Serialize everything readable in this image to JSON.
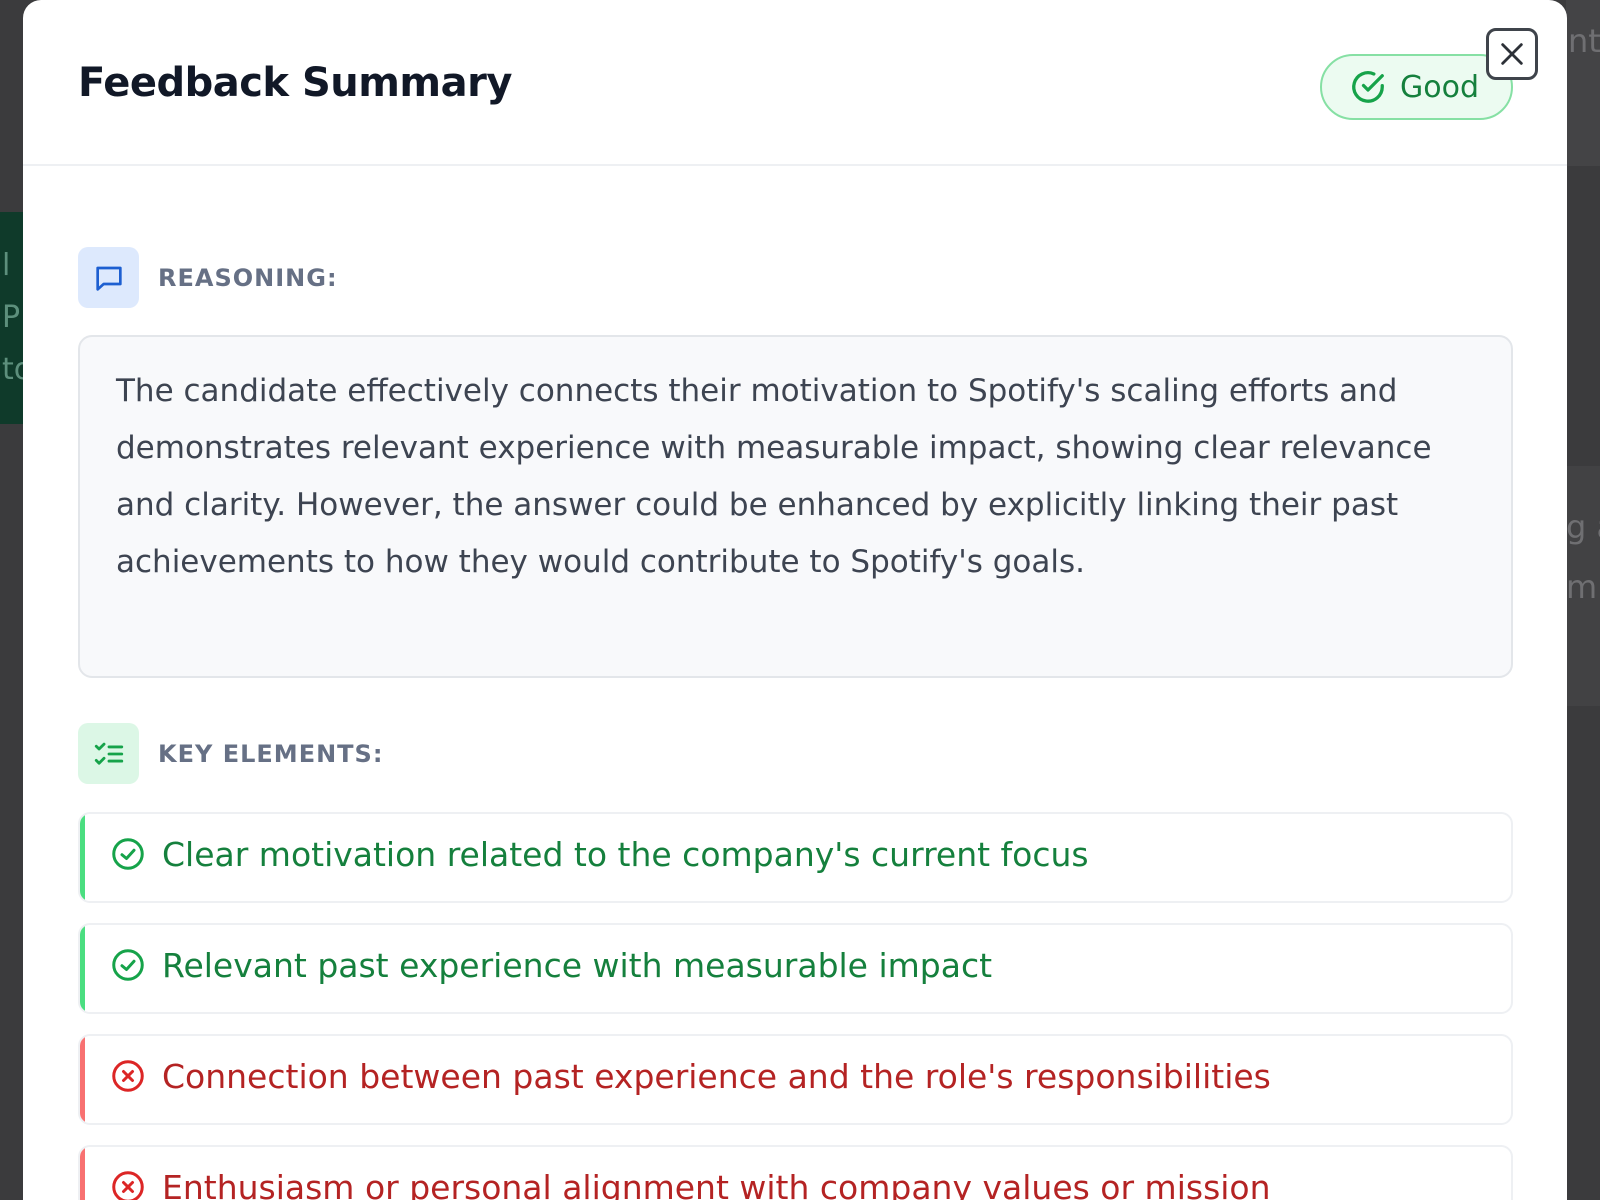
{
  "background": {
    "left_fragment": [
      "l",
      "P",
      "to"
    ],
    "right_top_fragment": "nts",
    "right_line_1": "g a",
    "right_line_2": "m"
  },
  "modal": {
    "title": "Feedback Summary",
    "rating": {
      "label": "Good",
      "icon": "check-circle-icon",
      "color": "#15803d"
    },
    "close_icon": "x-icon"
  },
  "reasoning": {
    "heading": "REASONING:",
    "icon": "message-square-icon",
    "text": "The candidate effectively connects their motivation to Spotify's scaling efforts and demonstrates relevant experience with measurable impact, showing clear relevance and clarity. However, the answer could be enhanced by explicitly linking their past achievements to how they would contribute to Spotify's goals."
  },
  "key_elements": {
    "heading": "KEY ELEMENTS:",
    "icon": "list-checks-icon",
    "items": [
      {
        "text": "Clear motivation related to the company's current focus",
        "status": "met",
        "icon": "check-circle-icon"
      },
      {
        "text": "Relevant past experience with measurable impact",
        "status": "met",
        "icon": "check-circle-icon"
      },
      {
        "text": "Connection between past experience and the role's responsibilities",
        "status": "unmet",
        "icon": "x-circle-icon"
      },
      {
        "text": "Enthusiasm or personal alignment with company values or mission",
        "status": "unmet",
        "icon": "x-circle-icon"
      }
    ]
  },
  "colors": {
    "met": "#15803d",
    "unmet": "#b42323",
    "accent_blue": "#1d5fd1"
  }
}
